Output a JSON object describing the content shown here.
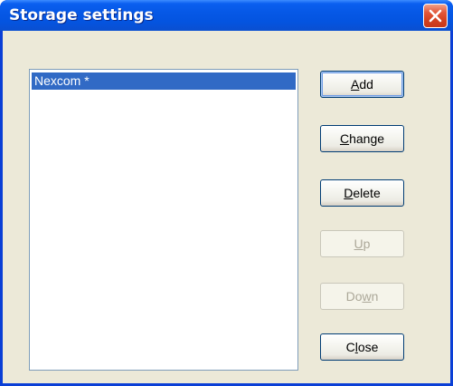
{
  "window": {
    "title": "Storage settings"
  },
  "list": {
    "items": [
      {
        "label": "Nexcom *",
        "selected": true
      }
    ]
  },
  "buttons": {
    "add": {
      "pre": "",
      "mnemonic": "A",
      "post": "dd",
      "enabled": true
    },
    "change": {
      "pre": "",
      "mnemonic": "C",
      "post": "hange",
      "enabled": true
    },
    "delete": {
      "pre": "",
      "mnemonic": "D",
      "post": "elete",
      "enabled": true
    },
    "up": {
      "pre": "",
      "mnemonic": "U",
      "post": "p",
      "enabled": false
    },
    "down": {
      "pre": "Do",
      "mnemonic": "w",
      "post": "n",
      "enabled": false
    },
    "close": {
      "pre": "C",
      "mnemonic": "l",
      "post": "ose",
      "enabled": true
    }
  },
  "colors": {
    "selection": "#316ac5",
    "dialog_face": "#ece9d8",
    "title_bar": "#0454e0",
    "close_button": "#d2401f"
  },
  "icons": {
    "close": "close-x-icon"
  }
}
